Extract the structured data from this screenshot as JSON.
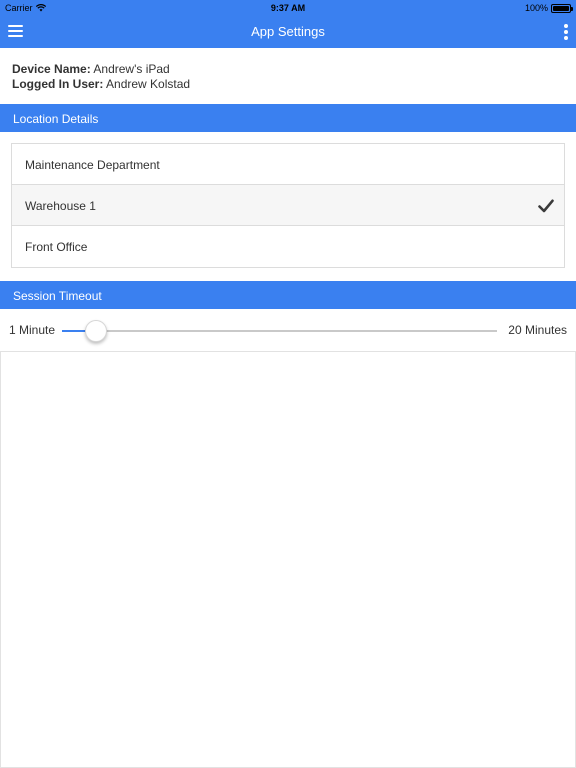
{
  "status_bar": {
    "carrier": "Carrier",
    "time": "9:37 AM",
    "battery_percent": "100%",
    "battery_level": 1.0
  },
  "nav_bar": {
    "title": "App Settings",
    "menu_icon": "hamburger-menu-icon",
    "more_icon": "vertical-ellipsis-icon",
    "color": "#3a80f0"
  },
  "device_info": {
    "device_name_label": "Device Name:",
    "device_name_value": "Andrew's iPad",
    "logged_in_label": "Logged In User:",
    "logged_in_value": "Andrew Kolstad"
  },
  "location_section": {
    "header": "Location Details",
    "items": [
      {
        "label": "Maintenance Department",
        "selected": false
      },
      {
        "label": "Warehouse 1",
        "selected": true
      },
      {
        "label": "Front Office",
        "selected": false
      }
    ],
    "selected_icon": "checkmark-icon"
  },
  "timeout_section": {
    "header": "Session Timeout",
    "min_label": "1 Minute",
    "max_label": "20 Minutes",
    "min_value": 1,
    "max_value": 20,
    "current_value": 2.5
  }
}
